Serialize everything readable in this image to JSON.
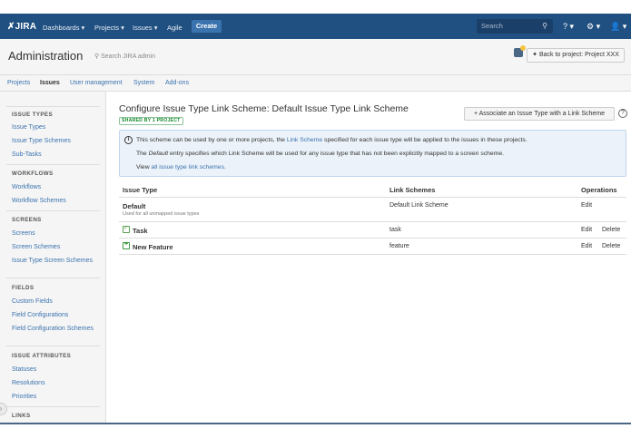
{
  "topbar": {
    "logo": "JIRA",
    "nav": [
      "Dashboards ▾",
      "Projects ▾",
      "Issues ▾",
      "Agile"
    ],
    "create": "Create",
    "search_placeholder": "Search"
  },
  "admin_header": {
    "title": "Administration",
    "search": "Search JIRA admin",
    "back": "Back to project: Project XXX"
  },
  "tabs": [
    "Projects",
    "Issues",
    "User management",
    "System",
    "Add-ons"
  ],
  "sidebar": {
    "sections": [
      {
        "head": "ISSUE TYPES",
        "items": [
          "Issue Types",
          "Issue Type Schemes",
          "Sub-Tasks"
        ]
      },
      {
        "head": "WORKFLOWS",
        "items": [
          "Workflows",
          "Workflow Schemes"
        ]
      },
      {
        "head": "SCREENS",
        "items": [
          "Screens",
          "Screen Schemes",
          "Issue Type Screen Schemes"
        ]
      },
      {
        "head": "FIELDS",
        "items": [
          "Custom Fields",
          "Field Configurations",
          "Field Configuration Schemes"
        ]
      },
      {
        "head": "ISSUE ATTRIBUTES",
        "items": [
          "Statuses",
          "Resolutions",
          "Priorities"
        ]
      },
      {
        "head": "LINKS",
        "items": []
      }
    ]
  },
  "main": {
    "title": "Configure Issue Type Link Scheme: Default Issue Type Link Scheme",
    "badge": "SHARED BY 1 PROJECT",
    "assoc_button": "Associate an Issue Type with a Link Scheme",
    "info": {
      "line1_a": "This scheme can be used by one or more projects, the",
      "line1_link": "Link Scheme",
      "line1_b": "specified for each issue type will be applied to the issues in these projects.",
      "line2_a": "The",
      "line2_em": "Default",
      "line2_b": "entry specifies which Link Scheme will be used for any issue type that has not been explicitly mapped to a screen scheme.",
      "line3_a": "View",
      "line3_link": "all issue type link schemes."
    },
    "table": {
      "headers": [
        "Issue Type",
        "Link Schemes",
        "Operations"
      ],
      "rows": [
        {
          "type": "Default",
          "sub": "Used for all unmapped issue types",
          "scheme": "Default Link Scheme",
          "ops": [
            "Edit"
          ]
        },
        {
          "type": "Task",
          "sub": "",
          "scheme": "task",
          "ops": [
            "Edit",
            "Delete"
          ]
        },
        {
          "type": "New Feature",
          "sub": "",
          "scheme": "feature",
          "ops": [
            "Edit",
            "Delete"
          ]
        }
      ]
    }
  }
}
